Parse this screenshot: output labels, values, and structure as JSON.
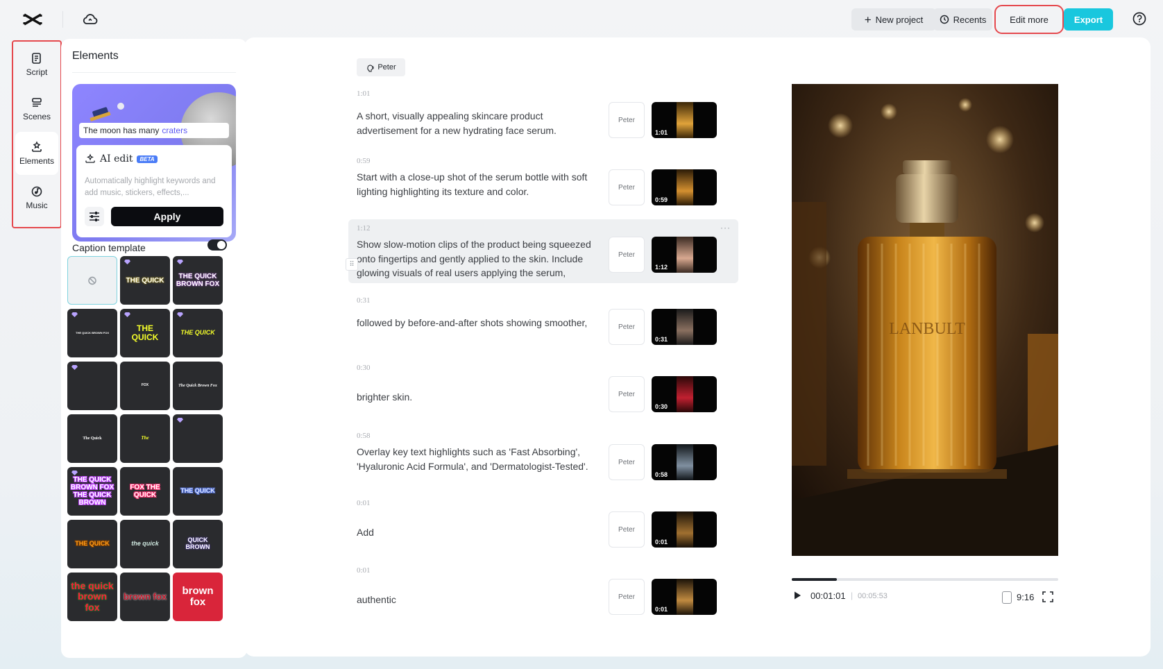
{
  "topbar": {
    "new_project": "New project",
    "recents": "Recents",
    "edit_more": "Edit more",
    "export": "Export"
  },
  "rail": {
    "items": [
      {
        "label": "Script",
        "icon": "script-icon"
      },
      {
        "label": "Scenes",
        "icon": "scenes-icon"
      },
      {
        "label": "Elements",
        "icon": "elements-icon",
        "active": true
      },
      {
        "label": "Music",
        "icon": "music-icon"
      }
    ]
  },
  "panel": {
    "title": "Elements",
    "ai_card": {
      "moon_caption": "The moon has many",
      "moon_keyword": "craters",
      "ai_edit_label": "AI edit",
      "beta": "BETA",
      "description": "Automatically highlight keywords and add music, stickers, effects,...",
      "apply": "Apply"
    },
    "caption_template": {
      "label": "Caption template",
      "enabled": true,
      "templates": [
        {
          "text": "",
          "kind": "none"
        },
        {
          "text": "THE QUICK",
          "premium": true
        },
        {
          "text": "THE QUICK BROWN FOX",
          "premium": true
        },
        {
          "text": "THE QUICK BROWN FOX",
          "premium": true
        },
        {
          "text": "THE QUICK",
          "premium": true
        },
        {
          "text": "THE QUICK",
          "premium": true
        },
        {
          "text": "",
          "premium": true
        },
        {
          "text": "FOX",
          "premium": false
        },
        {
          "text": "The Quick Brown Fox",
          "premium": false
        },
        {
          "text": "The Quick",
          "premium": false
        },
        {
          "text": "The",
          "premium": false
        },
        {
          "text": "",
          "premium": true
        },
        {
          "text": "THE QUICK BROWN FOX THE QUICK BROWN",
          "premium": true
        },
        {
          "text": "FOX THE QUICK",
          "premium": false
        },
        {
          "text": "THE QUICK",
          "premium": false
        },
        {
          "text": "THE QUICK",
          "premium": false
        },
        {
          "text": "the quick",
          "premium": false
        },
        {
          "text": "QUICK BROWN",
          "premium": false
        },
        {
          "text": "the quick brown fox",
          "premium": false
        },
        {
          "text": "brown fox",
          "premium": false
        },
        {
          "text": "brown fox",
          "premium": false
        }
      ]
    }
  },
  "script": {
    "speaker": "Peter",
    "segments": [
      {
        "time": "1:01",
        "text": "A short, visually appealing skincare product advertisement for a new hydrating face serum.",
        "voice": "Peter",
        "duration": "1:01"
      },
      {
        "time": "0:59",
        "text": "Start with a close-up shot of the serum bottle with soft lighting highlighting its texture and color.",
        "voice": "Peter",
        "duration": "0:59"
      },
      {
        "time": "1:12",
        "text": "Show slow-motion clips of the product being squeezed onto fingertips and gently applied to the skin. Include glowing visuals of real users applying the serum,",
        "voice": "Peter",
        "duration": "1:12",
        "more": "···"
      },
      {
        "time": "0:31",
        "text": "followed by before-and-after shots showing smoother,",
        "voice": "Peter",
        "duration": "0:31"
      },
      {
        "time": "0:30",
        "text": "brighter skin.",
        "voice": "Peter",
        "duration": "0:30"
      },
      {
        "time": "0:58",
        "text": "Overlay key text highlights such as 'Fast Absorbing', 'Hyaluronic Acid Formula', and 'Dermatologist-Tested'.",
        "voice": "Peter",
        "duration": "0:58"
      },
      {
        "time": "0:01",
        "text": "Add",
        "voice": "Peter",
        "duration": "0:01"
      },
      {
        "time": "0:01",
        "text": "authentic",
        "voice": "Peter",
        "duration": "0:01"
      }
    ]
  },
  "player": {
    "current_time": "00:01:01",
    "separator": "|",
    "total_time": "00:05:53",
    "aspect_ratio": "9:16",
    "progress": 0.17,
    "bottle_label": "LANBULT"
  },
  "colors": {
    "accent": "#19c7de",
    "highlight_border": "#e5484d",
    "keyword": "#5b57f2"
  }
}
